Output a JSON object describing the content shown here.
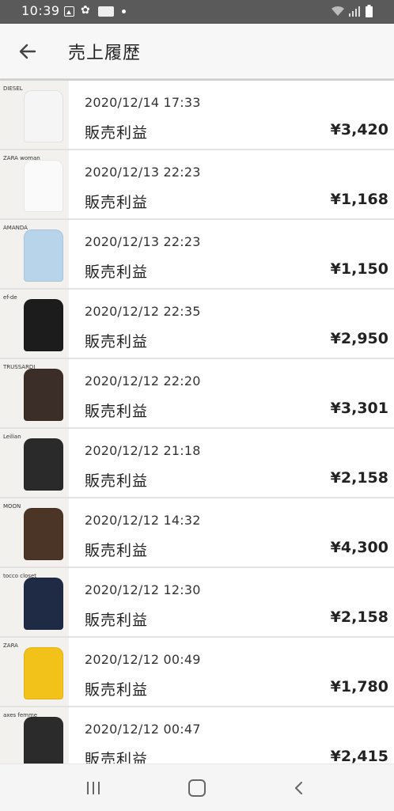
{
  "status_bar": {
    "time": "10:39",
    "icons": [
      "gallery-icon",
      "pinwheel-icon",
      "app-notification-icon",
      "dot-icon",
      "wifi-icon",
      "signal-icon",
      "battery-icon"
    ]
  },
  "app_bar": {
    "back_icon": "arrow-back-icon",
    "title": "売上履歴"
  },
  "sales": [
    {
      "brand": "DIESEL",
      "date": "2020/12/14 17:33",
      "type": "販売利益",
      "amount": "¥3,420",
      "garment_color": "#f5f5f5"
    },
    {
      "brand": "ZARA woman",
      "date": "2020/12/13 22:23",
      "type": "販売利益",
      "amount": "¥1,168",
      "garment_color": "#fafafa"
    },
    {
      "brand": "AMANDA",
      "date": "2020/12/13 22:23",
      "type": "販売利益",
      "amount": "¥1,150",
      "garment_color": "#b8d4ea"
    },
    {
      "brand": "ef-de",
      "date": "2020/12/12 22:35",
      "type": "販売利益",
      "amount": "¥2,950",
      "garment_color": "#1c1c1c"
    },
    {
      "brand": "TRUSSARDI",
      "date": "2020/12/12 22:20",
      "type": "販売利益",
      "amount": "¥3,301",
      "garment_color": "#3b2d28"
    },
    {
      "brand": "Leilian",
      "date": "2020/12/12 21:18",
      "type": "販売利益",
      "amount": "¥2,158",
      "garment_color": "#2a2a2a"
    },
    {
      "brand": "MOON",
      "date": "2020/12/12 14:32",
      "type": "販売利益",
      "amount": "¥4,300",
      "garment_color": "#4a3526"
    },
    {
      "brand": "tocco closet",
      "date": "2020/12/12 12:30",
      "type": "販売利益",
      "amount": "¥2,158",
      "garment_color": "#1f2a44"
    },
    {
      "brand": "ZARA",
      "date": "2020/12/12 00:49",
      "type": "販売利益",
      "amount": "¥1,780",
      "garment_color": "#f2c21a"
    },
    {
      "brand": "axes femme",
      "date": "2020/12/12 00:47",
      "type": "販売利益",
      "amount": "¥2,415",
      "garment_color": "#2b2b2b"
    }
  ],
  "nav_bar": {
    "recents_icon": "recents-icon",
    "home_icon": "home-icon",
    "back_icon": "nav-back-icon"
  }
}
